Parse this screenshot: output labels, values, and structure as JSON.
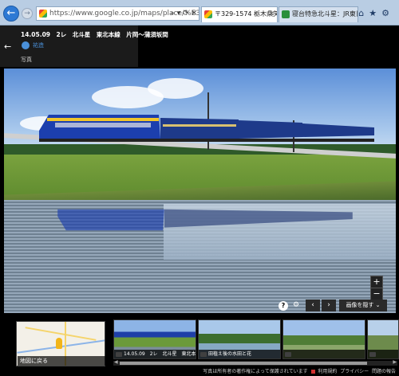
{
  "browser": {
    "url": "https://www.google.co.jp/maps/place/%E3%80%9232",
    "tabs": [
      {
        "title": "〒329-1574 栃木県矢...",
        "active": true
      },
      {
        "title": "寝台特急北斗星：JR東日本",
        "active": false
      }
    ],
    "toolbar_icons": [
      "home-icon",
      "star-icon",
      "gear-icon"
    ]
  },
  "info_panel": {
    "title": "14.05.09　2レ　北斗星　東北本線　片岡〜蒲須坂間",
    "author": "祐造",
    "label": "写真"
  },
  "photo_controls": {
    "zoom_in": "+",
    "zoom_out": "−",
    "help": "?",
    "prev": "‹",
    "next": "›",
    "hide_images": "画像を隠す"
  },
  "minimap": {
    "label": "地図に戻る"
  },
  "thumbnails": [
    {
      "caption": "14.05.09　2レ　北斗星　東北本線"
    },
    {
      "caption": "田植え後の水田と花"
    },
    {
      "caption": ""
    },
    {
      "caption": ""
    }
  ],
  "footer": {
    "text": "写真は所有者の著作権によって保護されています",
    "links": [
      "利用規約",
      "プライバシー",
      "問題の報告"
    ]
  },
  "colors": {
    "chrome": "#b9cde3",
    "link": "#4a90d9",
    "train": "#1c3fae"
  }
}
